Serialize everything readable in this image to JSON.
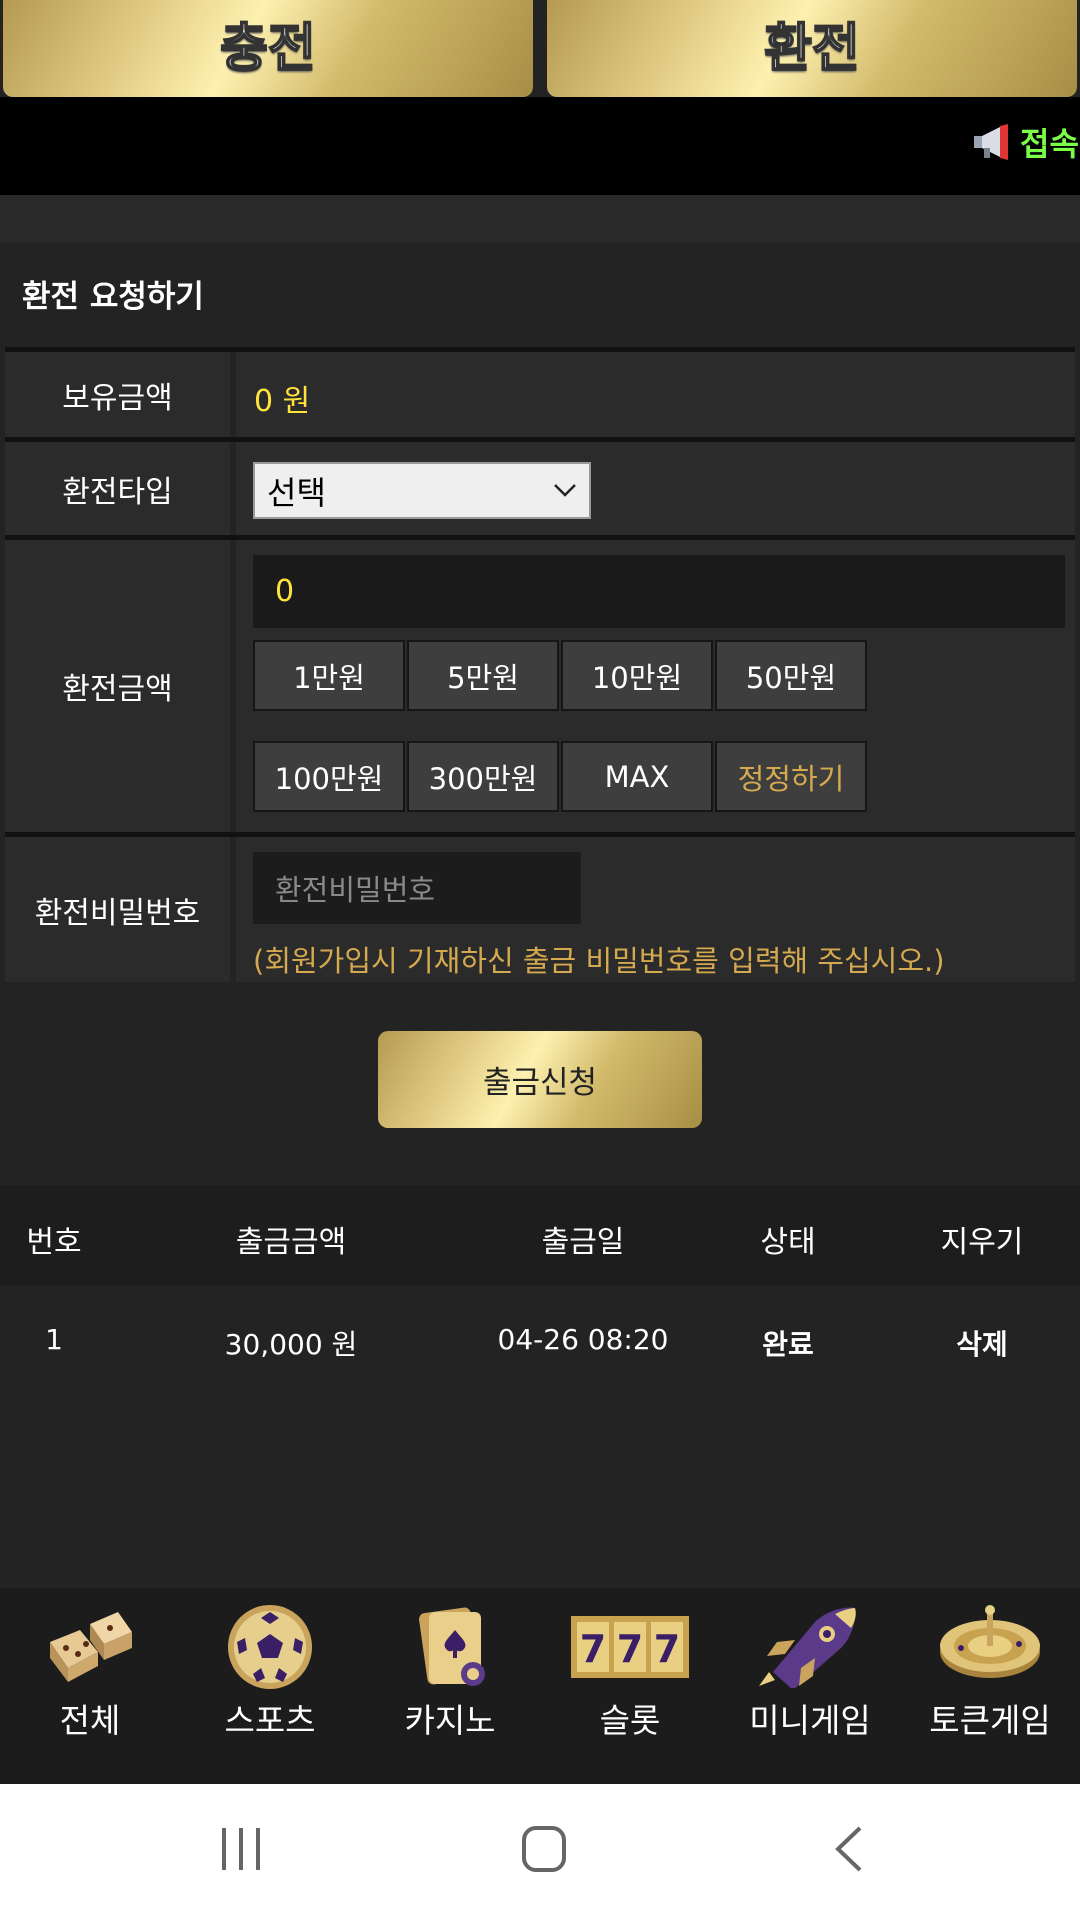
{
  "tabs": {
    "charge": "충전",
    "exchange": "환전"
  },
  "notice": {
    "text": "접속"
  },
  "form": {
    "title": "환전 요청하기",
    "balance_label": "보유금액",
    "balance_value": "0 원",
    "type_label": "환전타입",
    "type_selected": "선택",
    "amount_label": "환전금액",
    "amount_value": "0",
    "chips": [
      "1만원",
      "5만원",
      "10만원",
      "50만원",
      "100만원",
      "300만원",
      "MAX",
      "정정하기"
    ],
    "password_label": "환전비밀번호",
    "password_placeholder": "환전비밀번호",
    "password_hint": "(회원가입시 기재하신 출금 비밀번호를 입력해 주십시오.)",
    "submit": "출금신청"
  },
  "history": {
    "headers": [
      "번호",
      "출금금액",
      "출금일",
      "상태",
      "지우기"
    ],
    "rows": [
      {
        "no": "1",
        "amount": "30,000 원",
        "date": "04-26 08:20",
        "status": "완료",
        "action": "삭제"
      }
    ]
  },
  "bottom_nav": {
    "items": [
      {
        "label": "전체",
        "icon": "dice-icon"
      },
      {
        "label": "스포츠",
        "icon": "soccer-ball-icon"
      },
      {
        "label": "카지노",
        "icon": "playing-cards-icon"
      },
      {
        "label": "슬롯",
        "icon": "slot-777-icon"
      },
      {
        "label": "미니게임",
        "icon": "rocket-icon"
      },
      {
        "label": "토큰게임",
        "icon": "roulette-icon"
      }
    ]
  },
  "colors": {
    "gold": "#e8d38c",
    "yellow_text": "#ffe23a",
    "hint_text": "#d4a94f",
    "notice_green": "#7dff4a"
  }
}
